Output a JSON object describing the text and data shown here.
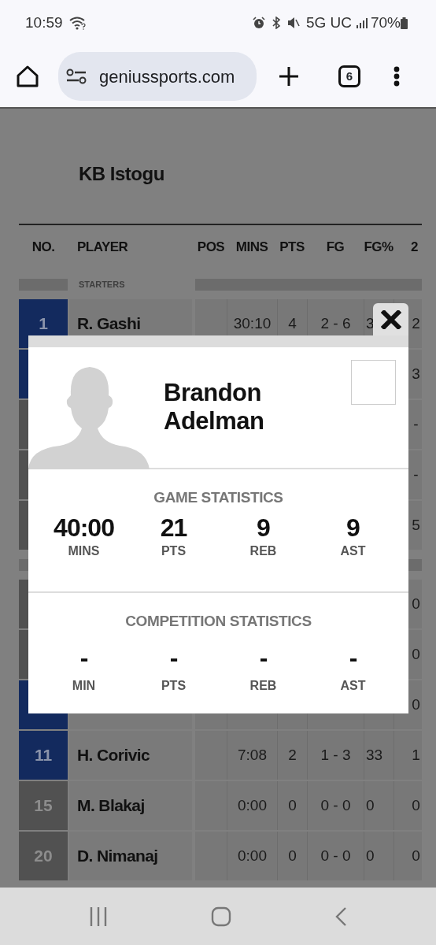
{
  "status_bar": {
    "time": "10:59",
    "network": "5G UC",
    "battery": "70%"
  },
  "browser": {
    "url": "geniussports.com",
    "tab_count": "6"
  },
  "team": {
    "name": "KB Istogu"
  },
  "table": {
    "columns": [
      "NO.",
      "PLAYER",
      "POS",
      "MINS",
      "PTS",
      "FG",
      "FG%",
      "2"
    ],
    "sections": [
      {
        "label": "STARTERS",
        "rows": [
          {
            "highlighted": true,
            "number": "1",
            "player": "R. Gashi",
            "cells": [
              "30:10",
              "4",
              "2 - 6",
              "3",
              "2"
            ]
          },
          {
            "highlighted": true,
            "edge_value": "3"
          },
          {
            "highlighted": false,
            "edge_value": "-"
          },
          {
            "highlighted": false,
            "edge_value": "-"
          },
          {
            "highlighted": false,
            "edge_value": "5"
          }
        ]
      },
      {
        "rows": [
          {
            "highlighted": false,
            "edge_value": "0"
          },
          {
            "highlighted": false,
            "edge_value": "0"
          },
          {
            "highlighted": true,
            "edge_value": "0"
          },
          {
            "highlighted": true,
            "number": "11",
            "player": "H. Corivic",
            "cells": [
              "7:08",
              "2",
              "1 - 3",
              "33",
              "1"
            ]
          },
          {
            "highlighted": false,
            "number": "15",
            "player": "M. Blakaj",
            "cells": [
              "0:00",
              "0",
              "0 - 0",
              "0",
              "0"
            ]
          },
          {
            "highlighted": false,
            "number": "20",
            "player": "D. Nimanaj",
            "cells": [
              "0:00",
              "0",
              "0 - 0",
              "0",
              "0"
            ]
          }
        ]
      }
    ]
  },
  "modal": {
    "first_name": "Brandon",
    "last_name": "Adelman",
    "groups": [
      {
        "title": "GAME STATISTICS",
        "kind": "game",
        "stats": [
          {
            "value": "40:00",
            "label": "MINS"
          },
          {
            "value": "21",
            "label": "PTS"
          },
          {
            "value": "9",
            "label": "REB"
          },
          {
            "value": "9",
            "label": "AST"
          }
        ]
      },
      {
        "title": "COMPETITION STATISTICS",
        "kind": "competition",
        "stats": [
          {
            "value": "-",
            "label": "MIN"
          },
          {
            "value": "-",
            "label": "PTS"
          },
          {
            "value": "-",
            "label": "REB"
          },
          {
            "value": "-",
            "label": "AST"
          }
        ]
      }
    ]
  }
}
